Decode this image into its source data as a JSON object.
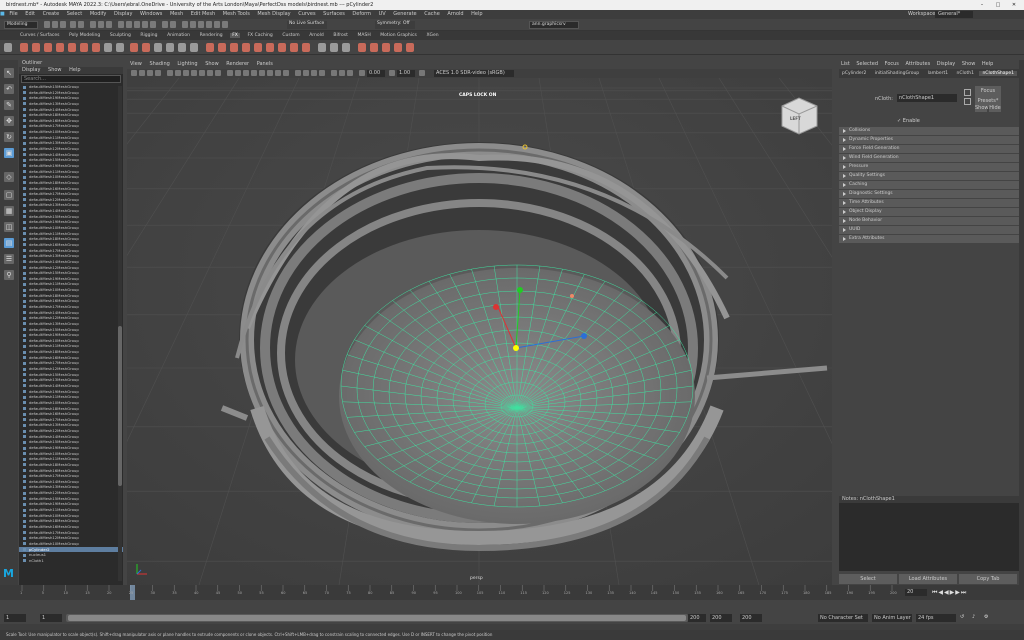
{
  "title": "birdnest.mb* - Autodesk MAYA 2022.3: C:\\Users\\ebral.OneDrive - University of the Arts London\\Maya\\PerfectDss models\\birdnest.mb   ---   pCylinder2",
  "menubar": [
    "File",
    "Edit",
    "Create",
    "Select",
    "Modify",
    "Display",
    "Windows",
    "Mesh",
    "Edit Mesh",
    "Mesh Tools",
    "Mesh Display",
    "Curves",
    "Surfaces",
    "Deform",
    "UV",
    "Generate",
    "Cache",
    "Arnold",
    "Help"
  ],
  "workspace": {
    "label": "Workspace:",
    "value": "General*"
  },
  "status": {
    "mode": "Modeling",
    "live": "No Live Surface",
    "symmetry": "Symmetry: Off",
    "user": "ann.graphicsrv"
  },
  "shelf_tabs": [
    "Curves / Surfaces",
    "Poly Modeling",
    "Sculpting",
    "Rigging",
    "Animation",
    "Rendering",
    "FX",
    "FX Caching",
    "Custom",
    "Arnold",
    "Bifrost",
    "MASH",
    "Motion Graphics",
    "XGen"
  ],
  "shelf_active_tab": "FX",
  "outliner": {
    "title": "Outliner",
    "menu": [
      "Display",
      "Show",
      "Help"
    ],
    "search_placeholder": "Search...",
    "items": [
      "defaultMesh15MeshGroup",
      "defaultMesh12MeshGroup",
      "defaultMesh19MeshGroup",
      "defaultMesh13MeshGroup",
      "defaultMesh14MeshGroup",
      "defaultMesh18MeshGroup",
      "defaultMesh16MeshGroup",
      "defaultMesh17MeshGroup",
      "defaultMesh10MeshGroup",
      "defaultMesh11MeshGroup",
      "defaultMesh13MeshGroup",
      "defaultMesh12MeshGroup",
      "defaultMesh14MeshGroup",
      "defaultMesh15MeshGroup",
      "defaultMesh19MeshGroup",
      "defaultMesh11MeshGroup",
      "defaultMesh10MeshGroup",
      "defaultMesh18MeshGroup",
      "defaultMesh16MeshGroup",
      "defaultMesh17MeshGroup",
      "defaultMesh12MeshGroup",
      "defaultMesh13MeshGroup",
      "defaultMesh14MeshGroup",
      "defaultMesh15MeshGroup",
      "defaultMesh19MeshGroup",
      "defaultMesh10MeshGroup",
      "defaultMesh11MeshGroup",
      "defaultMesh18MeshGroup",
      "defaultMesh16MeshGroup",
      "defaultMesh17MeshGroup",
      "defaultMesh13MeshGroup",
      "defaultMesh14MeshGroup",
      "defaultMesh12MeshGroup",
      "defaultMesh15MeshGroup",
      "defaultMesh19MeshGroup",
      "defaultMesh11MeshGroup",
      "defaultMesh10MeshGroup",
      "defaultMesh18MeshGroup",
      "defaultMesh16MeshGroup",
      "defaultMesh17MeshGroup",
      "defaultMesh14MeshGroup",
      "defaultMesh12MeshGroup",
      "defaultMesh13MeshGroup",
      "defaultMesh15MeshGroup",
      "defaultMesh19MeshGroup",
      "defaultMesh10MeshGroup",
      "defaultMesh11MeshGroup",
      "defaultMesh18MeshGroup",
      "defaultMesh16MeshGroup",
      "defaultMesh17MeshGroup",
      "defaultMesh12MeshGroup",
      "defaultMesh15MeshGroup",
      "defaultMesh13MeshGroup",
      "defaultMesh14MeshGroup",
      "defaultMesh19MeshGroup",
      "defaultMesh11MeshGroup",
      "defaultMesh10MeshGroup",
      "defaultMesh18MeshGroup",
      "defaultMesh16MeshGroup",
      "defaultMesh17MeshGroup",
      "defaultMesh13MeshGroup",
      "defaultMesh12MeshGroup",
      "defaultMesh14MeshGroup",
      "defaultMesh15MeshGroup",
      "defaultMesh19MeshGroup",
      "defaultMesh10MeshGroup",
      "defaultMesh11MeshGroup",
      "defaultMesh18MeshGroup",
      "defaultMesh16MeshGroup",
      "defaultMesh17MeshGroup",
      "defaultMesh14MeshGroup",
      "defaultMesh13MeshGroup",
      "defaultMesh12MeshGroup",
      "defaultMesh15MeshGroup",
      "defaultMesh19MeshGroup",
      "defaultMesh11MeshGroup",
      "defaultMesh10MeshGroup",
      "defaultMesh18MeshGroup",
      "defaultMesh16MeshGroup",
      "defaultMesh17MeshGroup",
      "defaultMesh12MeshGroup",
      "defaultMesh10MeshGroup",
      "pCylinder2",
      "nucleus1",
      "nCloth1"
    ],
    "selected": "pCylinder2"
  },
  "viewport": {
    "menu": [
      "View",
      "Shading",
      "Lighting",
      "Show",
      "Renderer",
      "Panels"
    ],
    "caps_lock": "CAPS LOCK ON",
    "camera": "persp",
    "viewcube": "LEFT",
    "field1": "0.00",
    "field2": "1.00",
    "colorspace": "ACES 1.0 SDR-video (sRGB)"
  },
  "attr_editor": {
    "menu": [
      "List",
      "Selected",
      "Focus",
      "Attributes",
      "Display",
      "Show",
      "Help"
    ],
    "tabs": [
      "pCylinder2",
      "initialShadingGroup",
      "lambert1",
      "nCloth1",
      "nClothShape1"
    ],
    "active_tab": "nClothShape1",
    "node_label": "nCloth:",
    "node_value": "nClothShape1",
    "focus": "Focus",
    "presets": "Presets*",
    "show": "Show",
    "hide": "Hide",
    "enable": "Enable",
    "sections": [
      "Collisions",
      "Dynamic Properties",
      "Force Field Generation",
      "Wind Field Generation",
      "Pressure",
      "Quality Settings",
      "Caching",
      "Diagnostic Settings",
      "Time Attributes",
      "Object Display",
      "Node Behavior",
      "UUID",
      "Extra Attributes"
    ],
    "notes": "Notes:  nClothShape1",
    "buttons": [
      "Select",
      "Load Attributes",
      "Copy Tab"
    ]
  },
  "time": {
    "ticks": [
      "1",
      "5",
      "10",
      "15",
      "20",
      "25",
      "30",
      "35",
      "40",
      "45",
      "50",
      "55",
      "60",
      "65",
      "70",
      "75",
      "80",
      "85",
      "90",
      "95",
      "100",
      "105",
      "110",
      "115",
      "120",
      "125",
      "130",
      "135",
      "140",
      "145",
      "150",
      "155",
      "160",
      "165",
      "170",
      "175",
      "180",
      "185",
      "190",
      "195",
      "200"
    ],
    "current": "20",
    "range_start": "1",
    "range_start2": "1",
    "range_end": "200",
    "range_end2": "200",
    "anim_end": "200",
    "fps": "24 fps",
    "no_char": "No Character Set",
    "no_anim": "No Anim Layer"
  },
  "helpline": "Scale Tool: Use manipulator to scale object(s). Shift+drag manipulator axis or plane handles to extrude components or clone objects. Ctrl+Shift+LMB+drag to constrain scaling to connected edges. Use D or INSERT to change the pivot position"
}
